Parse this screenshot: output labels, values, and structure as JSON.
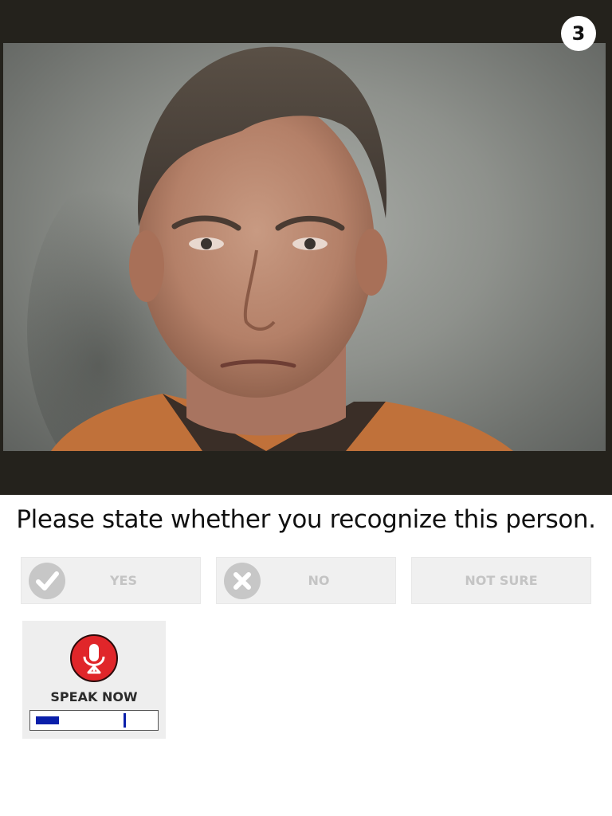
{
  "counter": {
    "value": "3"
  },
  "photo": {
    "description_icon": "portrait-photo"
  },
  "prompt": {
    "text": "Please state whether you recognize this person."
  },
  "answers": [
    {
      "label": "YES",
      "icon": "check-icon"
    },
    {
      "label": "NO",
      "icon": "x-icon"
    },
    {
      "label": "NOT SURE",
      "icon": ""
    }
  ],
  "speak": {
    "label": "SPEAK NOW",
    "icon": "microphone-icon",
    "level": 0.2,
    "peak": 0.75
  },
  "colors": {
    "frame": "#24221c",
    "button_bg": "#f0f0f0",
    "button_text": "#c4c4c4",
    "mic_red": "#e0262a",
    "meter_blue": "#0a1faa"
  }
}
